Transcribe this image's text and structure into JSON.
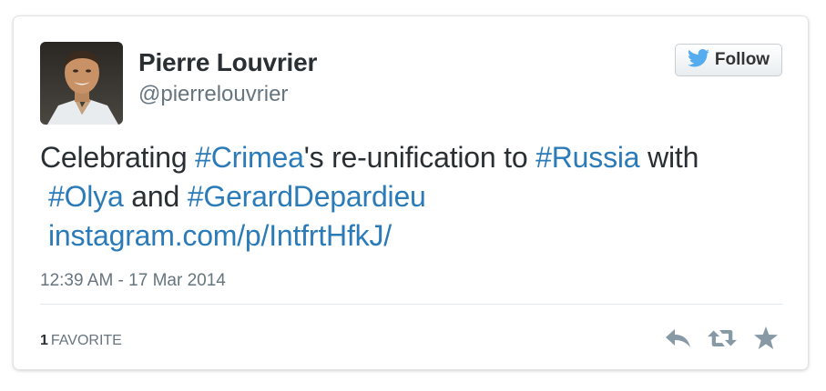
{
  "user": {
    "display_name": "Pierre Louvrier",
    "handle": "@pierrelouvrier",
    "avatar_icon": "profile-photo"
  },
  "follow_button": {
    "label": "Follow",
    "icon": "twitter-bird-icon",
    "bird_color": "#55acee"
  },
  "tweet": {
    "line1": {
      "t1": "Celebrating ",
      "tag1": "#Crimea",
      "t2": "'s re-unification to ",
      "tag2": "#Russia",
      "t3": " with"
    },
    "line2": {
      "tag1": "#Olya",
      "t1": " and ",
      "tag2": "#GerardDepardieu"
    },
    "line3": {
      "link": "instagram.com/p/IntfrtHfkJ/"
    },
    "timestamp": "12:39 AM - 17 Mar 2014"
  },
  "stats": {
    "count": "1",
    "label": "FAVORITE"
  },
  "actions": [
    {
      "name": "reply",
      "icon": "reply-icon"
    },
    {
      "name": "retweet",
      "icon": "retweet-icon"
    },
    {
      "name": "favorite",
      "icon": "star-icon"
    }
  ],
  "colors": {
    "link": "#2b7bb9",
    "text": "#292f33",
    "muted": "#66757f",
    "action_icon": "#8899a6"
  }
}
